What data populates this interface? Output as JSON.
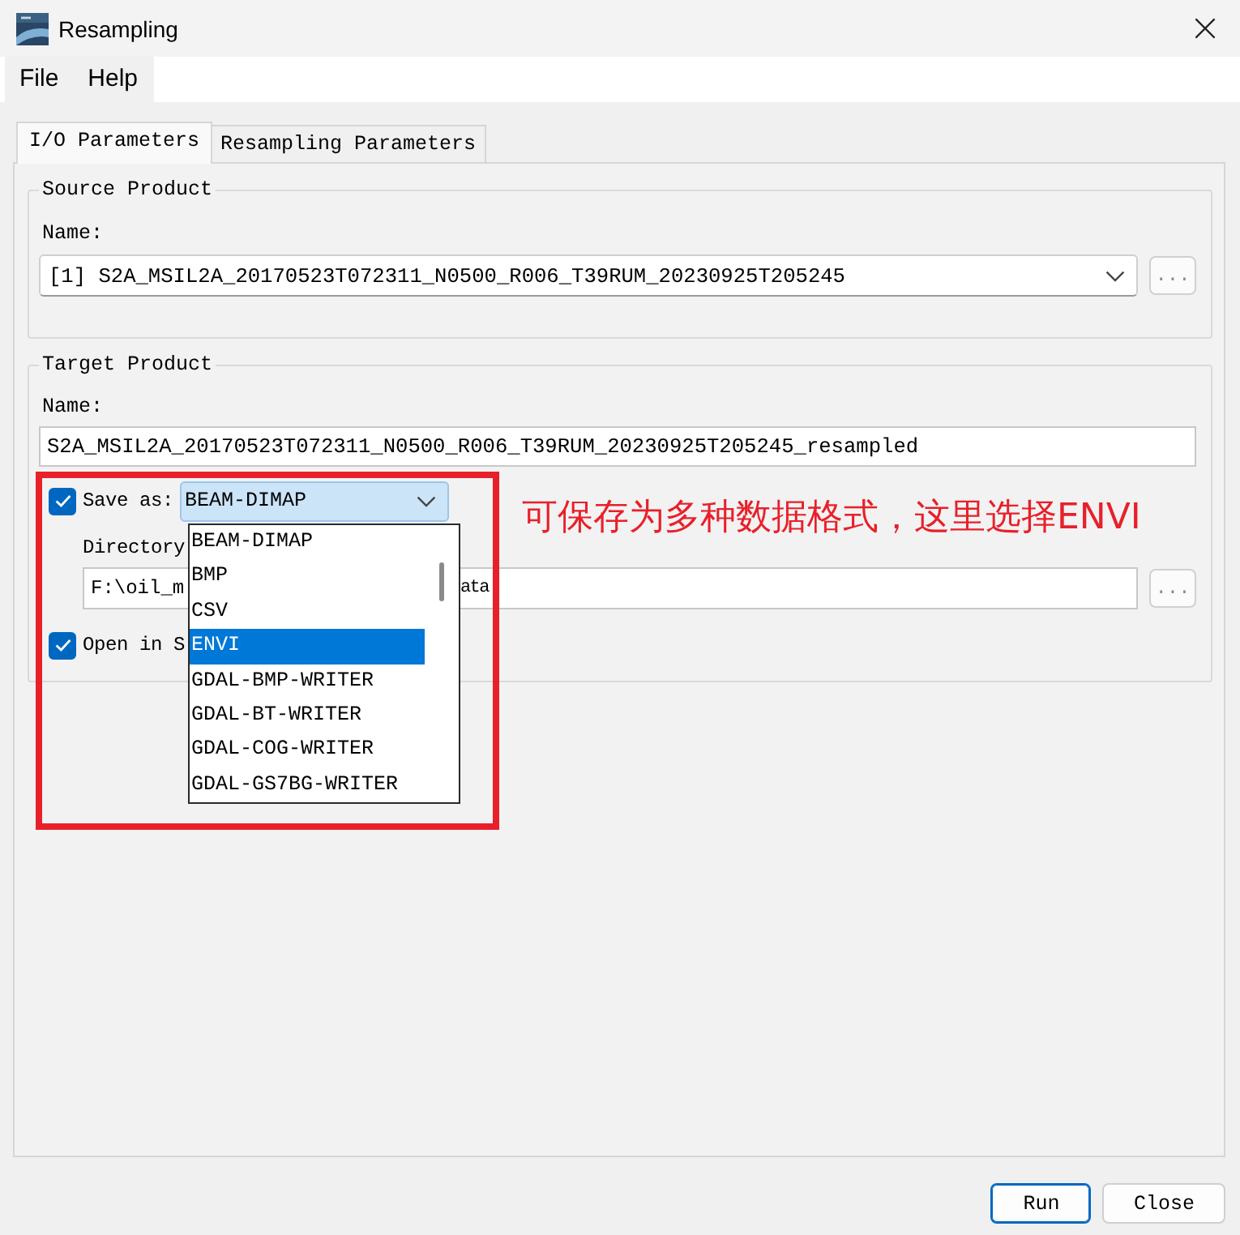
{
  "window": {
    "title": "Resampling"
  },
  "menu": [
    {
      "label": "File"
    },
    {
      "label": "Help"
    }
  ],
  "tabs": [
    {
      "label": "I/O Parameters",
      "selected": true
    },
    {
      "label": "Resampling Parameters",
      "selected": false
    }
  ],
  "source_product": {
    "title": "Source Product",
    "name_label": "Name:",
    "name_value": "[1] S2A_MSIL2A_20170523T072311_N0500_R006_T39RUM_20230925T205245",
    "browse_button": "..."
  },
  "target_product": {
    "title": "Target Product",
    "name_label": "Name:",
    "name_value": "S2A_MSIL2A_20170523T072311_N0500_R006_T39RUM_20230925T205245_resampled",
    "save_as": {
      "label": "Save as:",
      "checked": true,
      "format": "BEAM-DIMAP",
      "options": [
        {
          "label": "BEAM-DIMAP",
          "selected": false
        },
        {
          "label": "BMP",
          "selected": false
        },
        {
          "label": "CSV",
          "selected": false
        },
        {
          "label": "ENVI",
          "selected": true
        },
        {
          "label": "GDAL-BMP-WRITER",
          "selected": false
        },
        {
          "label": "GDAL-BT-WRITER",
          "selected": false
        },
        {
          "label": "GDAL-COG-WRITER",
          "selected": false
        },
        {
          "label": "GDAL-GS7BG-WRITER",
          "selected": false
        }
      ]
    },
    "directory": {
      "label": "Directory",
      "value_start": "F:\\oil_m",
      "value_end": "ata",
      "browse_button": "..."
    },
    "open_checkbox": {
      "label": "Open in S",
      "checked": true
    }
  },
  "annotation": {
    "text": "可保存为多种数据格式，这里选择ENVI"
  },
  "buttons": [
    {
      "label": "Run",
      "default": true
    },
    {
      "label": "Close",
      "default": false
    }
  ]
}
